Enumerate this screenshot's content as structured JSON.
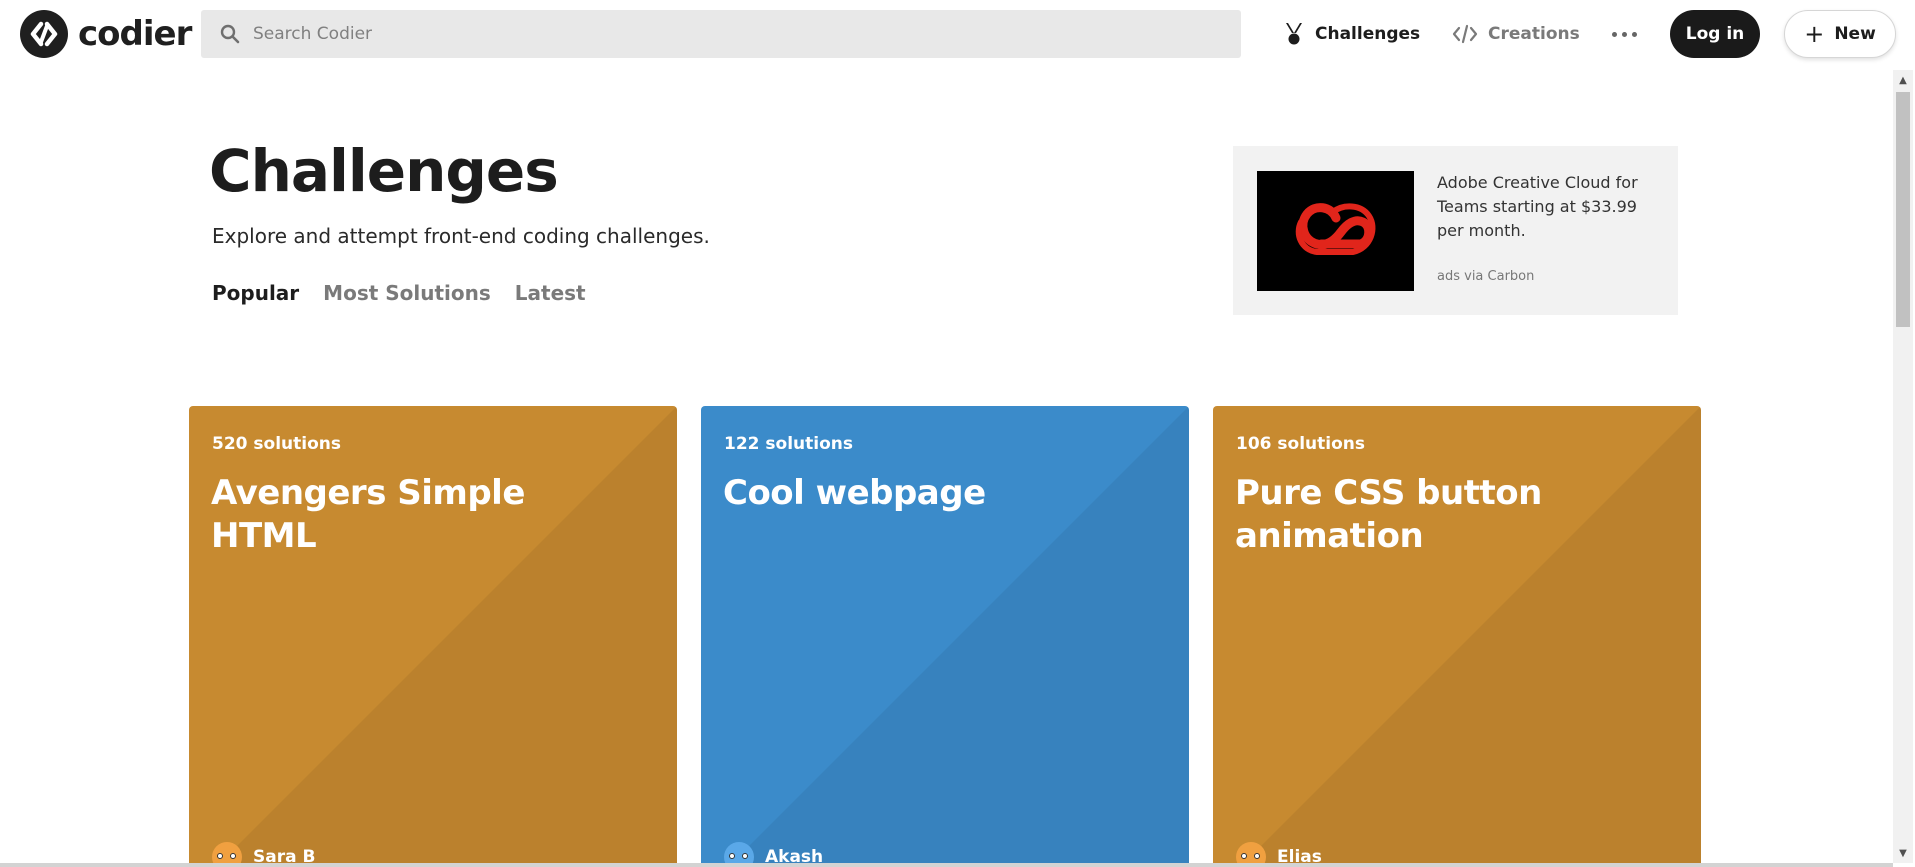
{
  "header": {
    "logo_text": "codier",
    "search_placeholder": "Search Codier",
    "nav": {
      "challenges": "Challenges",
      "creations": "Creations"
    },
    "login_label": "Log in",
    "new_label": "New"
  },
  "hero": {
    "title": "Challenges",
    "subtitle": "Explore and attempt front-end coding challenges.",
    "filters": [
      "Popular",
      "Most Solutions",
      "Latest"
    ],
    "active_filter": "Popular"
  },
  "ad": {
    "text": "Adobe Creative Cloud for Teams starting at $33.99 per month.",
    "via": "ads via Carbon"
  },
  "cards": [
    {
      "solutions": "520 solutions",
      "title": "Avengers Simple HTML",
      "author": "Sara B",
      "color": "#c78a30",
      "avatar_color": "#f0a040"
    },
    {
      "solutions": "122 solutions",
      "title": "Cool webpage",
      "author": "Akash",
      "color": "#3b8bca",
      "avatar_color": "#5aa8e8"
    },
    {
      "solutions": "106 solutions",
      "title": "Pure CSS button animation",
      "author": "Elias",
      "color": "#c78a30",
      "avatar_color": "#f0a040"
    }
  ],
  "colors": {
    "text": "#1d1d1d",
    "muted": "#7a7a7a",
    "card_orange": "#c78a30",
    "card_blue": "#3b8bca",
    "ad_red": "#e1251b"
  }
}
